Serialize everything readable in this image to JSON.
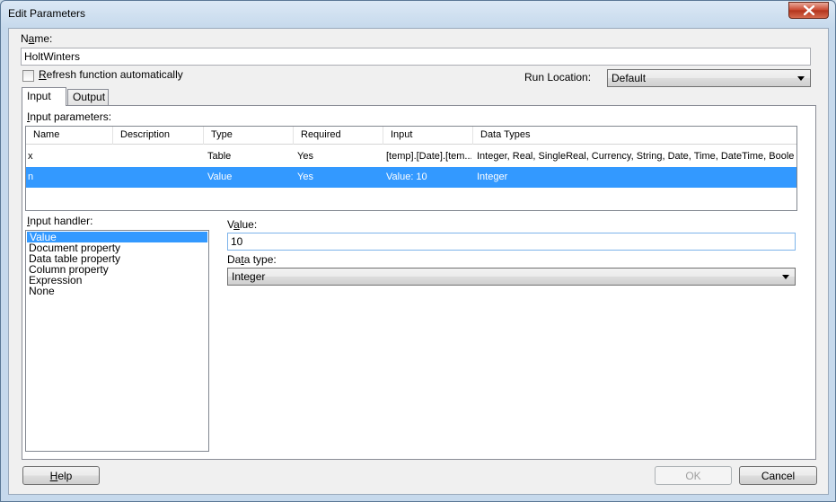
{
  "window": {
    "title": "Edit Parameters"
  },
  "name_field": {
    "label_prefix": "N",
    "label_underlined": "a",
    "label_suffix": "me:",
    "value": "HoltWinters"
  },
  "refresh": {
    "label_underlined": "R",
    "label_rest": "efresh function automatically",
    "checked": false
  },
  "run_location": {
    "label": "Run Location:",
    "value": "Default"
  },
  "tabs": [
    {
      "label": "Input",
      "active": true
    },
    {
      "label": "Output",
      "active": false
    }
  ],
  "input_parameters": {
    "label_underlined": "I",
    "label_rest": "nput parameters:",
    "columns": [
      "Name",
      "Description",
      "Type",
      "Required",
      "Input",
      "Data Types"
    ],
    "rows": [
      {
        "name": "x",
        "description": "",
        "type": "Table",
        "required": "Yes",
        "input": "[temp].[Date].[tem...",
        "data_types": "Integer, Real, SingleReal, Currency, String, Date, Time, DateTime, Boole...",
        "selected": false
      },
      {
        "name": "n",
        "description": "",
        "type": "Value",
        "required": "Yes",
        "input": "Value: 10",
        "data_types": "Integer",
        "selected": true
      }
    ]
  },
  "input_handler": {
    "label_underlined": "I",
    "label_rest": "nput handler:",
    "items": [
      "Value",
      "Document property",
      "Data table property",
      "Column property",
      "Expression",
      "None"
    ],
    "selected_index": 0
  },
  "value_field": {
    "label_prefix": "V",
    "label_underlined": "a",
    "label_suffix": "lue:",
    "value": "10"
  },
  "data_type": {
    "label_prefix": "Da",
    "label_underlined": "t",
    "label_suffix": "a type:",
    "value": "Integer"
  },
  "buttons": {
    "help": {
      "label_underlined": "H",
      "label_rest": "elp"
    },
    "ok": {
      "label": "OK",
      "enabled": false
    },
    "cancel": {
      "label": "Cancel"
    }
  },
  "colors": {
    "selection": "#3399ff",
    "close_button": "#c8452d"
  }
}
